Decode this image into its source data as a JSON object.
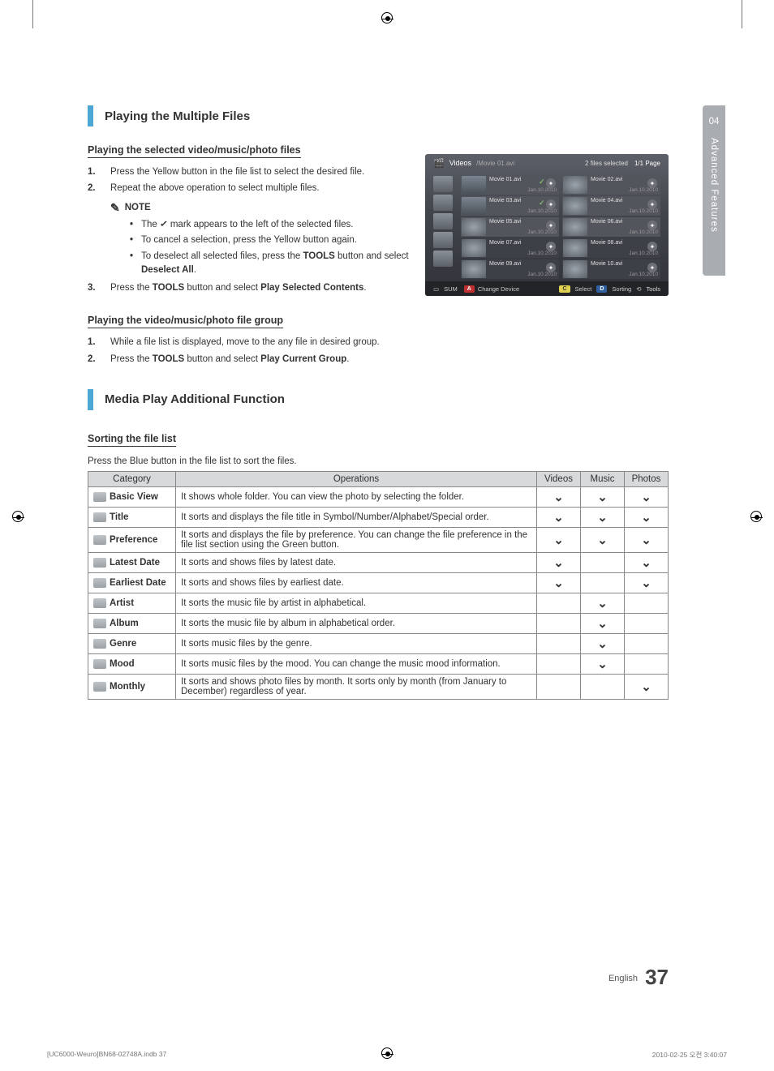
{
  "sidebar": {
    "chapter_num": "04",
    "chapter_title": "Advanced Features"
  },
  "section1": {
    "title": "Playing the Multiple Files",
    "sub1": "Playing the selected video/music/photo files",
    "steps1": [
      "Press the Yellow button in the file list to select the desired file.",
      "Repeat the above operation to select multiple files."
    ],
    "note_label": "NOTE",
    "notes": [
      "The ✓ mark appears to the left of the selected files.",
      "To cancel a selection, press the Yellow button again."
    ],
    "note3_pre": "To deselect all selected files, press the ",
    "note3_tools": "TOOLS",
    "note3_mid": " button and select ",
    "note3_deselect": "Deselect All",
    "note3_post": ".",
    "step3_pre": "Press the ",
    "step3_tools": "TOOLS",
    "step3_mid": " button and select ",
    "step3_play": "Play Selected Contents",
    "step3_post": ".",
    "sub2": "Playing the video/music/photo file group",
    "steps2_1": "While a file list is displayed, move to the any file in desired group.",
    "steps2_2_pre": "Press the ",
    "steps2_2_tools": "TOOLS",
    "steps2_2_mid": " button and select ",
    "steps2_2_play": "Play Current Group",
    "steps2_2_post": "."
  },
  "section2": {
    "title": "Media Play Additional Function",
    "sub": "Sorting the file list",
    "desc": "Press the Blue button in the file list to sort the files."
  },
  "preview": {
    "label": "Videos",
    "path": "/Movie 01.avi",
    "selected_text": "2 files selected",
    "page_text": "1/1 Page",
    "items": [
      {
        "name": "Movie 01.avi",
        "date": "Jan.10.2010",
        "checked": true,
        "thumb": "img"
      },
      {
        "name": "Movie 02.avi",
        "date": "Jan.10.2010",
        "checked": false,
        "thumb": "clip"
      },
      {
        "name": "Movie 03.avi",
        "date": "Jan.10.2010",
        "checked": true,
        "thumb": "img"
      },
      {
        "name": "Movie 04.avi",
        "date": "Jan.10.2010",
        "checked": false,
        "thumb": "clip"
      },
      {
        "name": "Movie 05.avi",
        "date": "Jan.10.2010",
        "checked": false,
        "thumb": "clip"
      },
      {
        "name": "Movie 06.avi",
        "date": "Jan.10.2010",
        "checked": false,
        "thumb": "clip"
      },
      {
        "name": "Movie 07.avi",
        "date": "Jan.10.2010",
        "checked": false,
        "thumb": "clip",
        "hover": true
      },
      {
        "name": "Movie 08.avi",
        "date": "Jan.10.2010",
        "checked": false,
        "thumb": "clip",
        "hover": true
      },
      {
        "name": "Movie 09.avi",
        "date": "Jan.10.2010",
        "checked": false,
        "thumb": "clip",
        "hover": true
      },
      {
        "name": "Movie 10.avi",
        "date": "Jan.10.2010",
        "checked": false,
        "thumb": "clip",
        "hover": true
      }
    ],
    "footer": {
      "sum": "SUM",
      "key_a": "A",
      "change": "Change Device",
      "key_c": "C",
      "select": "Select",
      "key_d": "D",
      "sorting": "Sorting",
      "tools": "Tools"
    }
  },
  "table": {
    "headers": {
      "category": "Category",
      "operations": "Operations",
      "videos": "Videos",
      "music": "Music",
      "photos": "Photos"
    },
    "rows": [
      {
        "cat": "Basic View",
        "op": "It shows whole folder. You can view the photo by selecting the folder.",
        "v": true,
        "m": true,
        "p": true
      },
      {
        "cat": "Title",
        "op": "It sorts and displays the file title in Symbol/Number/Alphabet/Special order.",
        "v": true,
        "m": true,
        "p": true
      },
      {
        "cat": "Preference",
        "op": "It sorts and displays the file by preference. You can change the file preference in the file list section using the Green button.",
        "v": true,
        "m": true,
        "p": true
      },
      {
        "cat": "Latest Date",
        "op": "It sorts and shows files by latest date.",
        "v": true,
        "m": false,
        "p": true
      },
      {
        "cat": "Earliest Date",
        "op": "It sorts and shows files by earliest date.",
        "v": true,
        "m": false,
        "p": true
      },
      {
        "cat": "Artist",
        "op": "It sorts the music file by artist in alphabetical.",
        "v": false,
        "m": true,
        "p": false
      },
      {
        "cat": "Album",
        "op": "It sorts the music file by album in alphabetical order.",
        "v": false,
        "m": true,
        "p": false
      },
      {
        "cat": "Genre",
        "op": "It sorts music files by the genre.",
        "v": false,
        "m": true,
        "p": false
      },
      {
        "cat": "Mood",
        "op": "It sorts music files by the mood. You can change the music mood information.",
        "v": false,
        "m": true,
        "p": false
      },
      {
        "cat": "Monthly",
        "op": "It sorts and shows photo files by month. It sorts only by month (from January to December) regardless of year.",
        "v": false,
        "m": false,
        "p": true
      }
    ]
  },
  "footer": {
    "lang": "English",
    "page": "37"
  },
  "meta": {
    "left": "[UC6000-Weuro]BN68-02748A.indb   37",
    "right": "2010-02-25   오전 3:40:07"
  }
}
